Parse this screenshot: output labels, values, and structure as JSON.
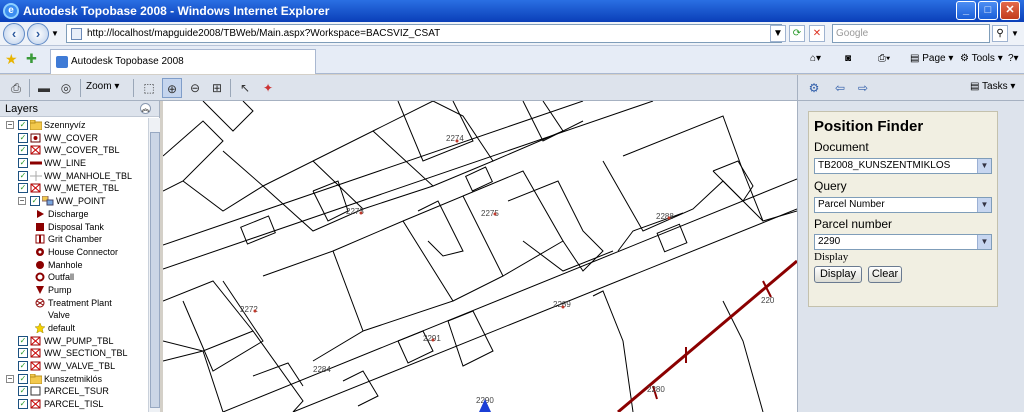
{
  "window": {
    "title": "Autodesk Topobase 2008 - Windows Internet Explorer",
    "controls": [
      "_",
      "□",
      "✕"
    ]
  },
  "browser": {
    "back": "‹",
    "forward": "›",
    "address": "http://localhost/mapguide2008/TBWeb/Main.aspx?Workspace=BACSVIZ_CSAT",
    "search_placeholder": "Google",
    "tab_title": "Autodesk Topobase 2008",
    "commands": {
      "page": "Page",
      "tools": "Tools"
    }
  },
  "toolbar": {
    "zoom_label": "Zoom",
    "icons": [
      "print-icon",
      "measure-icon",
      "buffer-icon",
      "zoom-rect-icon",
      "zoom-in-icon",
      "zoom-out-icon",
      "zoom-extents-icon",
      "select-icon",
      "select-radius-icon"
    ]
  },
  "layers": {
    "header": "Layers",
    "items": [
      {
        "label": "Szennyvíz",
        "level": 0,
        "kind": "group",
        "checked": true
      },
      {
        "label": "WW_COVER",
        "level": 1,
        "kind": "layer",
        "checked": true,
        "symbol": "cover"
      },
      {
        "label": "WW_COVER_TBL",
        "level": 1,
        "kind": "layer",
        "checked": true,
        "symbol": "x"
      },
      {
        "label": "WW_LINE",
        "level": 1,
        "kind": "layer",
        "checked": true,
        "symbol": "line"
      },
      {
        "label": "WW_MANHOLE_TBL",
        "level": 1,
        "kind": "layer",
        "checked": true,
        "symbol": "cross"
      },
      {
        "label": "WW_METER_TBL",
        "level": 1,
        "kind": "layer",
        "checked": true,
        "symbol": "x"
      },
      {
        "label": "WW_POINT",
        "level": 1,
        "kind": "group",
        "checked": true,
        "symbol": "multi"
      },
      {
        "label": "Discharge",
        "level": 2,
        "kind": "legend",
        "symbol": "triangle"
      },
      {
        "label": "Disposal Tank",
        "level": 2,
        "kind": "legend",
        "symbol": "square"
      },
      {
        "label": "Grit Chamber",
        "level": 2,
        "kind": "legend",
        "symbol": "grit"
      },
      {
        "label": "House Connector",
        "level": 2,
        "kind": "legend",
        "symbol": "house"
      },
      {
        "label": "Manhole",
        "level": 2,
        "kind": "legend",
        "symbol": "circle"
      },
      {
        "label": "Outfall",
        "level": 2,
        "kind": "legend",
        "symbol": "outfall"
      },
      {
        "label": "Pump",
        "level": 2,
        "kind": "legend",
        "symbol": "pump"
      },
      {
        "label": "Treatment Plant",
        "level": 2,
        "kind": "legend",
        "symbol": "plant"
      },
      {
        "label": "Valve",
        "level": 2,
        "kind": "legend",
        "symbol": "none"
      },
      {
        "label": "default",
        "level": 2,
        "kind": "legend",
        "symbol": "star"
      },
      {
        "label": "WW_PUMP_TBL",
        "level": 1,
        "kind": "layer",
        "checked": true,
        "symbol": "x"
      },
      {
        "label": "WW_SECTION_TBL",
        "level": 1,
        "kind": "layer",
        "checked": true,
        "symbol": "x"
      },
      {
        "label": "WW_VALVE_TBL",
        "level": 1,
        "kind": "layer",
        "checked": true,
        "symbol": "x"
      },
      {
        "label": "Kunszetmiklós",
        "level": 0,
        "kind": "group",
        "checked": true
      },
      {
        "label": "PARCEL_TSUR",
        "level": 1,
        "kind": "layer",
        "checked": true,
        "symbol": "empty"
      },
      {
        "label": "PARCEL_TISL",
        "level": 1,
        "kind": "layer",
        "checked": true,
        "symbol": "x"
      }
    ]
  },
  "map": {
    "parcel_labels": [
      "2274",
      "2273",
      "2275",
      "2288",
      "2272",
      "2289",
      "2291",
      "2284",
      "2290",
      "220",
      "2280"
    ]
  },
  "task": {
    "menu_label": "Tasks",
    "position_finder": {
      "title": "Position Finder",
      "document_label": "Document",
      "document_value": "TB2008_KUNSZENTMIKLOS",
      "query_label": "Query",
      "query_value": "Parcel Number",
      "parcel_label": "Parcel number",
      "parcel_value": "2290",
      "display_label": "Display",
      "display_button": "Display",
      "clear_button": "Clear"
    }
  },
  "colors": {
    "title_bar": "#0a3fb8",
    "sewer_line": "#8b0000",
    "parcel_dot": "#c0392b",
    "check": "#2a9a2a"
  }
}
